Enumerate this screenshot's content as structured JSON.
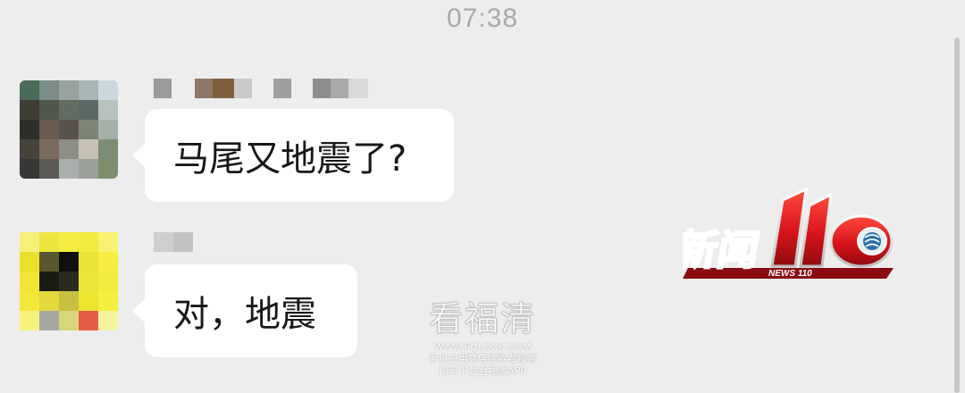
{
  "status_bar": {
    "time": "07:38"
  },
  "messages": [
    {
      "text": "马尾又地震了?"
    },
    {
      "text": "对，地震"
    }
  ],
  "logo": {
    "main": "新闻110",
    "sub": "NEWS 110",
    "colors": {
      "red": "#d8141b",
      "silver": "#dcdcdc"
    }
  },
  "watermark": {
    "title": "看福清",
    "url": "WWW.FQLOOK.COM",
    "line1": "手机应用商店搜索看福清",
    "line2": "均可下载看福清APP"
  },
  "colors": {
    "background": "#ededed",
    "bubble": "#ffffff",
    "text": "#181818"
  }
}
